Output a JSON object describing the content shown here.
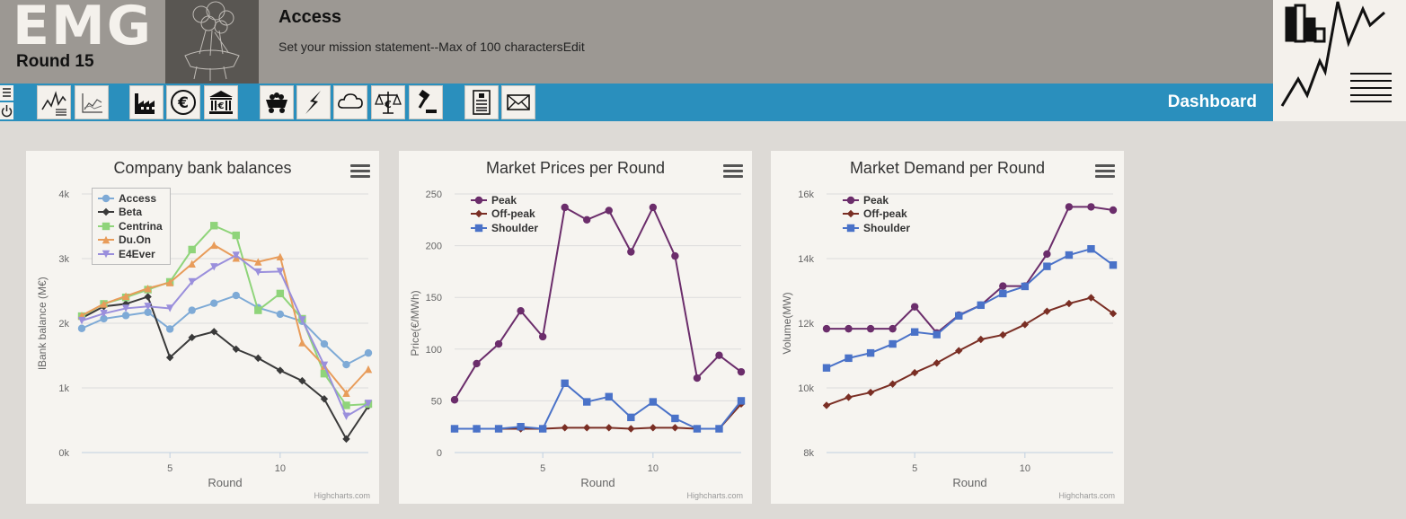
{
  "header": {
    "logo_text": "EMG",
    "round": "Round 15",
    "company": "Access",
    "mission": "Set your mission statement--Max of 100 characters",
    "mission_edit": "Edit"
  },
  "toolbar": {
    "title": "Dashboard",
    "buttons": [
      "list-icon",
      "dashboard-charts-icon",
      "trend-chart-icon",
      "factory-icon",
      "euro-icon",
      "bank-icon",
      "coal-cart-icon",
      "lightning-icon",
      "cloud-icon",
      "euro-scale-icon",
      "gavel-icon",
      "document-icon",
      "mail-icon"
    ]
  },
  "colors": {
    "toolbar": "#2a8fbd",
    "header": "#9c9893",
    "access": "#7eaad6",
    "beta": "#3a3a3a",
    "centrina": "#8fd47a",
    "duon": "#e89c5a",
    "e4ever": "#9a8fdc",
    "peak": "#6b2d6b",
    "offpeak": "#7a2e24",
    "shoulder": "#4a72c8"
  },
  "charts": {
    "balances": {
      "title": "Company bank balances",
      "credits": "Highcharts.com"
    },
    "prices": {
      "title": "Market Prices per Round",
      "credits": "Highcharts.com"
    },
    "demand": {
      "title": "Market Demand per Round",
      "credits": "Highcharts.com"
    }
  },
  "chart_data": [
    {
      "type": "line",
      "title": "Company bank balances",
      "xlabel": "Round",
      "ylabel": "lBank balance (M€)",
      "xlim": [
        1,
        14
      ],
      "ylim": [
        0,
        4000
      ],
      "yticks": [
        0,
        1000,
        2000,
        3000,
        4000
      ],
      "ytick_labels": [
        "0k",
        "1k",
        "2k",
        "3k",
        "4k"
      ],
      "xticks": [
        5,
        10
      ],
      "legend": "top-left",
      "x": [
        1,
        2,
        3,
        4,
        5,
        6,
        7,
        8,
        9,
        10,
        11,
        12,
        13,
        14
      ],
      "series": [
        {
          "name": "Access",
          "color": "#7eaad6",
          "marker": "circle",
          "values": [
            1920,
            2070,
            2120,
            2170,
            1910,
            2200,
            2310,
            2430,
            2240,
            2140,
            2030,
            1680,
            1360,
            1540
          ]
        },
        {
          "name": "Beta",
          "color": "#3a3a3a",
          "marker": "diamond",
          "values": [
            2080,
            2260,
            2300,
            2410,
            1470,
            1780,
            1870,
            1600,
            1460,
            1270,
            1110,
            830,
            210,
            720
          ]
        },
        {
          "name": "Centrina",
          "color": "#8fd47a",
          "marker": "square",
          "values": [
            2110,
            2300,
            2400,
            2520,
            2640,
            3140,
            3510,
            3360,
            2200,
            2460,
            2070,
            1220,
            730,
            750
          ]
        },
        {
          "name": "Du.On",
          "color": "#e89c5a",
          "marker": "triangle",
          "values": [
            2120,
            2300,
            2420,
            2540,
            2630,
            2920,
            3210,
            3010,
            2950,
            3030,
            1700,
            1340,
            920,
            1290
          ]
        },
        {
          "name": "E4Ever",
          "color": "#9a8fdc",
          "marker": "triangle-down",
          "values": [
            2040,
            2150,
            2230,
            2260,
            2230,
            2640,
            2870,
            3050,
            2790,
            2800,
            2050,
            1350,
            560,
            760
          ]
        }
      ]
    },
    {
      "type": "line",
      "title": "Market Prices per Round",
      "xlabel": "Round",
      "ylabel": "Price(€/MWh)",
      "xlim": [
        1,
        14
      ],
      "ylim": [
        0,
        250
      ],
      "yticks": [
        0,
        50,
        100,
        150,
        200,
        250
      ],
      "ytick_labels": [
        "0",
        "50",
        "100",
        "150",
        "200",
        "250"
      ],
      "xticks": [
        5,
        10
      ],
      "legend": "top-left",
      "x": [
        1,
        2,
        3,
        4,
        5,
        6,
        7,
        8,
        9,
        10,
        11,
        12,
        13,
        14
      ],
      "series": [
        {
          "name": "Peak",
          "color": "#6b2d6b",
          "marker": "circle",
          "values": [
            51,
            86,
            105,
            137,
            112,
            237,
            225,
            234,
            194,
            237,
            190,
            72,
            94,
            78
          ]
        },
        {
          "name": "Off-peak",
          "color": "#7a2e24",
          "marker": "diamond",
          "values": [
            23,
            23,
            23,
            23,
            23,
            24,
            24,
            24,
            23,
            24,
            24,
            23,
            23,
            47
          ]
        },
        {
          "name": "Shoulder",
          "color": "#4a72c8",
          "marker": "square",
          "values": [
            23,
            23,
            23,
            25,
            23,
            67,
            49,
            54,
            34,
            49,
            33,
            23,
            23,
            50
          ]
        }
      ]
    },
    {
      "type": "line",
      "title": "Market Demand per Round",
      "xlabel": "Round",
      "ylabel": "Volume(MW)",
      "xlim": [
        1,
        14
      ],
      "ylim": [
        8000,
        16000
      ],
      "yticks": [
        8000,
        10000,
        12000,
        14000,
        16000
      ],
      "ytick_labels": [
        "8k",
        "10k",
        "12k",
        "14k",
        "16k"
      ],
      "xticks": [
        5,
        10
      ],
      "legend": "top-left",
      "x": [
        1,
        2,
        3,
        4,
        5,
        6,
        7,
        8,
        9,
        10,
        11,
        12,
        13,
        14
      ],
      "series": [
        {
          "name": "Peak",
          "color": "#6b2d6b",
          "marker": "circle",
          "values": [
            11830,
            11830,
            11830,
            11830,
            12510,
            11700,
            12250,
            12560,
            13150,
            13150,
            14140,
            15600,
            15600,
            15500
          ]
        },
        {
          "name": "Off-peak",
          "color": "#7a2e24",
          "marker": "diamond",
          "values": [
            9460,
            9710,
            9860,
            10120,
            10470,
            10770,
            11150,
            11500,
            11640,
            11960,
            12370,
            12610,
            12790,
            12300
          ]
        },
        {
          "name": "Shoulder",
          "color": "#4a72c8",
          "marker": "square",
          "values": [
            10620,
            10920,
            11080,
            11360,
            11730,
            11650,
            12230,
            12560,
            12920,
            13140,
            13760,
            14110,
            14300,
            13800
          ]
        }
      ]
    }
  ]
}
